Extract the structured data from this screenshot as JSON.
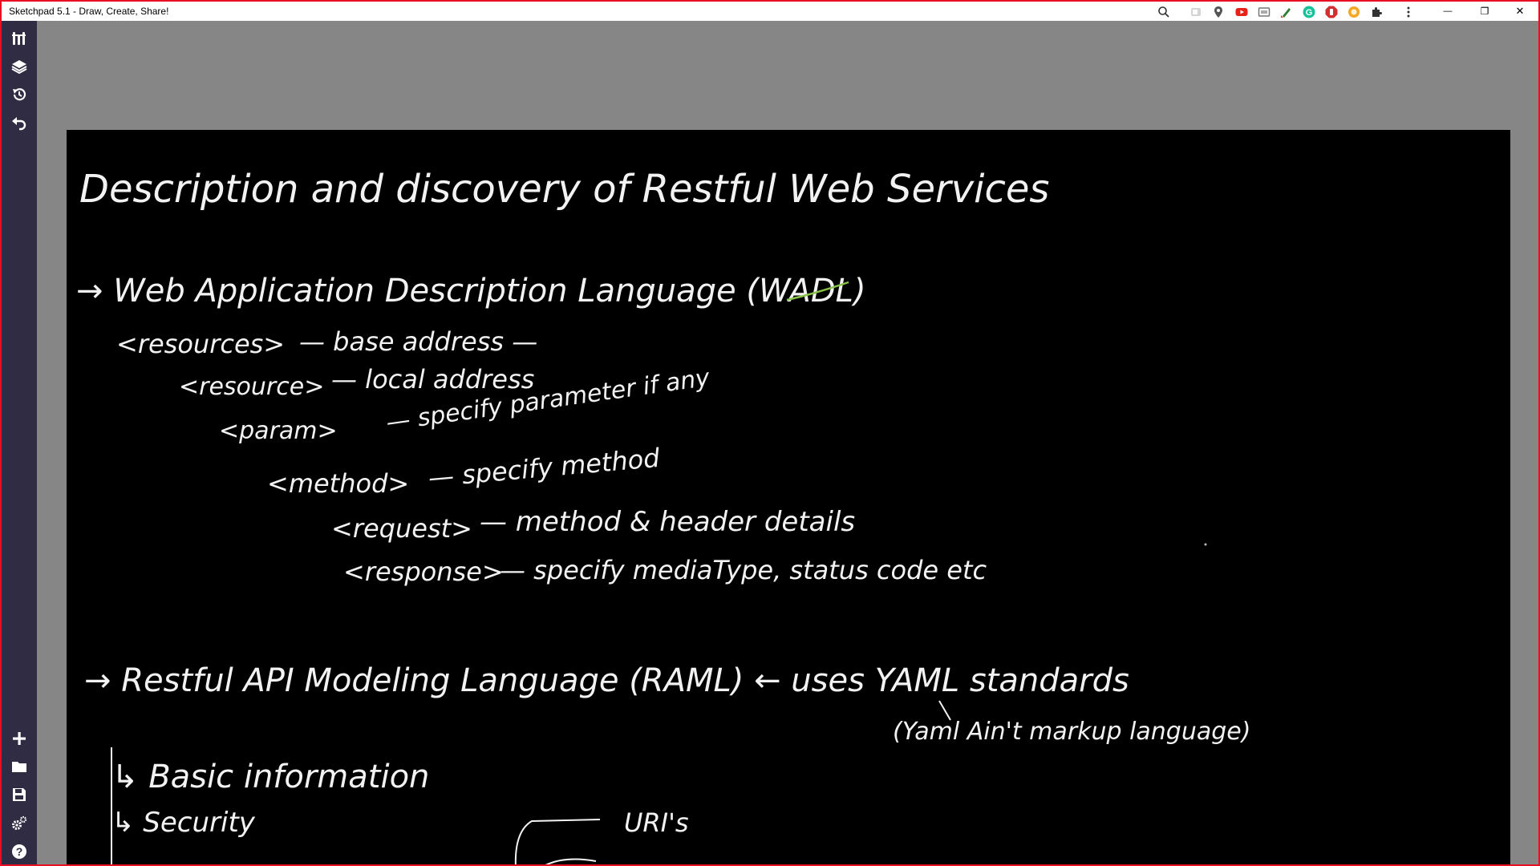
{
  "window": {
    "title": "Sketchpad 5.1 - Draw, Create, Share!",
    "controls": {
      "minimize": "—",
      "restore": "❐",
      "close": "✕"
    }
  },
  "browser_toolbar": {
    "icons": [
      "zoom-icon",
      "extension-icon",
      "maps-pin-icon",
      "youtube-icon",
      "screenshot-icon",
      "pen-extension-icon",
      "grammarly-icon",
      "adblock-icon",
      "honey-icon",
      "puzzle-icon",
      "kebab-menu-icon"
    ]
  },
  "sidebar": {
    "top_tools": [
      "brush-tools-icon",
      "layers-icon",
      "history-icon",
      "undo-icon"
    ],
    "bottom_tools": [
      "new-icon",
      "open-folder-icon",
      "save-icon",
      "settings-icon",
      "help-icon"
    ]
  },
  "drawing": {
    "title": "Description and discovery of Restful Web Services",
    "wadl_heading": "→ Web Application Description Language (WADL)",
    "wadl_items": [
      {
        "tag": "<resources>",
        "desc": "— base address —"
      },
      {
        "tag": "<resource>",
        "desc": "— local address"
      },
      {
        "tag": "<param>",
        "desc": "— specify parameter if any"
      },
      {
        "tag": "<method>",
        "desc": "— specify method"
      },
      {
        "tag": "<request>",
        "desc": "— method & header details"
      },
      {
        "tag": "<response>",
        "desc": "— specify mediaType, status code etc"
      }
    ],
    "raml_heading": "→ Restful API Modeling Language (RAML) ← uses YAML standards",
    "yaml_note": "(Yaml Ain't markup language)",
    "raml_items": [
      "↳ Basic information",
      "↳ Security"
    ],
    "uris_label": "URI's",
    "colors": {
      "ink": "#f2f2f2",
      "check": "#8bc34a",
      "canvas": "#000000"
    }
  }
}
